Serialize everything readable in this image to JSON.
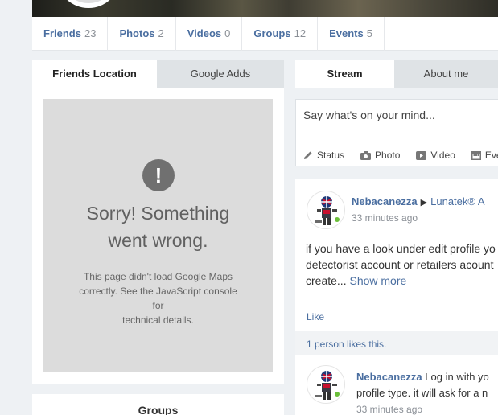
{
  "profile_nav": [
    {
      "label": "Friends",
      "count": "23"
    },
    {
      "label": "Photos",
      "count": "2"
    },
    {
      "label": "Videos",
      "count": "0"
    },
    {
      "label": "Groups",
      "count": "12"
    },
    {
      "label": "Events",
      "count": "5"
    }
  ],
  "left_panel": {
    "tabs": {
      "active": "Friends Location",
      "inactive": "Google Adds"
    },
    "map_error": {
      "icon": "!",
      "title_line1": "Sorry! Something",
      "title_line2": "went wrong.",
      "desc_line1": "This page didn't load Google Maps",
      "desc_line2": "correctly. See the JavaScript console for",
      "desc_line3": "technical details."
    }
  },
  "groups_panel": {
    "title": "Groups"
  },
  "stream": {
    "tabs": {
      "active": "Stream",
      "inactive": "About me"
    },
    "composer": {
      "placeholder": "Say what's on your mind...",
      "actions": {
        "status": "Status",
        "photo": "Photo",
        "video": "Video",
        "event": "Eve"
      }
    },
    "post": {
      "author": "Nebacanezza",
      "arrow": "▶",
      "target": "Lunatek® A",
      "time": "33 minutes ago",
      "body_line1": "if you have a look under edit profile yo",
      "body_line2": "detectorist account or retailers acount",
      "body_line3": "create...",
      "show_more": "Show more",
      "like": "Like",
      "likes_summary": "1 person likes this."
    },
    "comment": {
      "author": "Nebacanezza",
      "text_line1": "Log in with yo",
      "text_line2": "profile type. it will ask for a n",
      "time": "33 minutes ago"
    }
  },
  "colors": {
    "link": "#4a6ea0",
    "page_bg": "#eef1f4",
    "map_bg": "#dcdcdc",
    "online": "#6bbf3a"
  }
}
